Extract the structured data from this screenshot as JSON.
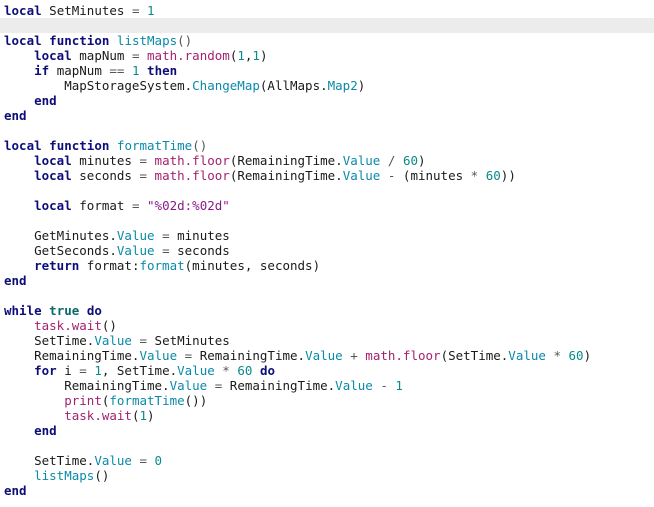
{
  "editor": {
    "lines": [
      [
        {
          "t": "kw",
          "v": "local"
        },
        {
          "t": "plain",
          "v": " SetMinutes "
        },
        {
          "t": "op",
          "v": "="
        },
        {
          "t": "plain",
          "v": " "
        },
        {
          "t": "num",
          "v": "1"
        }
      ],
      [],
      [
        {
          "t": "kw",
          "v": "local"
        },
        {
          "t": "plain",
          "v": " "
        },
        {
          "t": "kw",
          "v": "function"
        },
        {
          "t": "plain",
          "v": " "
        },
        {
          "t": "fn",
          "v": "listMaps"
        },
        {
          "t": "op",
          "v": "()"
        }
      ],
      [
        {
          "t": "plain",
          "v": "    "
        },
        {
          "t": "kw",
          "v": "local"
        },
        {
          "t": "plain",
          "v": " mapNum "
        },
        {
          "t": "op",
          "v": "="
        },
        {
          "t": "plain",
          "v": " "
        },
        {
          "t": "bi",
          "v": "math.random"
        },
        {
          "t": "plain",
          "v": "("
        },
        {
          "t": "num",
          "v": "1"
        },
        {
          "t": "plain",
          "v": ","
        },
        {
          "t": "num",
          "v": "1"
        },
        {
          "t": "plain",
          "v": ")"
        }
      ],
      [
        {
          "t": "plain",
          "v": "    "
        },
        {
          "t": "kw",
          "v": "if"
        },
        {
          "t": "plain",
          "v": " mapNum "
        },
        {
          "t": "op",
          "v": "=="
        },
        {
          "t": "plain",
          "v": " "
        },
        {
          "t": "num",
          "v": "1"
        },
        {
          "t": "plain",
          "v": " "
        },
        {
          "t": "kw",
          "v": "then"
        }
      ],
      [
        {
          "t": "plain",
          "v": "        MapStorageSystem."
        },
        {
          "t": "pr",
          "v": "ChangeMap"
        },
        {
          "t": "plain",
          "v": "(AllMaps."
        },
        {
          "t": "pr",
          "v": "Map2"
        },
        {
          "t": "plain",
          "v": ")"
        }
      ],
      [
        {
          "t": "plain",
          "v": "    "
        },
        {
          "t": "kw",
          "v": "end"
        }
      ],
      [
        {
          "t": "kw",
          "v": "end"
        }
      ],
      [],
      [
        {
          "t": "kw",
          "v": "local"
        },
        {
          "t": "plain",
          "v": " "
        },
        {
          "t": "kw",
          "v": "function"
        },
        {
          "t": "plain",
          "v": " "
        },
        {
          "t": "fn",
          "v": "formatTime"
        },
        {
          "t": "op",
          "v": "()"
        }
      ],
      [
        {
          "t": "plain",
          "v": "    "
        },
        {
          "t": "kw",
          "v": "local"
        },
        {
          "t": "plain",
          "v": " minutes "
        },
        {
          "t": "op",
          "v": "="
        },
        {
          "t": "plain",
          "v": " "
        },
        {
          "t": "bi",
          "v": "math.floor"
        },
        {
          "t": "plain",
          "v": "(RemainingTime."
        },
        {
          "t": "pr",
          "v": "Value"
        },
        {
          "t": "plain",
          "v": " "
        },
        {
          "t": "op",
          "v": "/"
        },
        {
          "t": "plain",
          "v": " "
        },
        {
          "t": "num",
          "v": "60"
        },
        {
          "t": "plain",
          "v": ")"
        }
      ],
      [
        {
          "t": "plain",
          "v": "    "
        },
        {
          "t": "kw",
          "v": "local"
        },
        {
          "t": "plain",
          "v": " seconds "
        },
        {
          "t": "op",
          "v": "="
        },
        {
          "t": "plain",
          "v": " "
        },
        {
          "t": "bi",
          "v": "math.floor"
        },
        {
          "t": "plain",
          "v": "(RemainingTime."
        },
        {
          "t": "pr",
          "v": "Value"
        },
        {
          "t": "plain",
          "v": " "
        },
        {
          "t": "op",
          "v": "-"
        },
        {
          "t": "plain",
          "v": " (minutes "
        },
        {
          "t": "op",
          "v": "*"
        },
        {
          "t": "plain",
          "v": " "
        },
        {
          "t": "num",
          "v": "60"
        },
        {
          "t": "plain",
          "v": "))"
        }
      ],
      [],
      [
        {
          "t": "plain",
          "v": "    "
        },
        {
          "t": "kw",
          "v": "local"
        },
        {
          "t": "plain",
          "v": " format "
        },
        {
          "t": "op",
          "v": "="
        },
        {
          "t": "plain",
          "v": " "
        },
        {
          "t": "str",
          "v": "\"%02d:%02d\""
        }
      ],
      [],
      [
        {
          "t": "plain",
          "v": "    GetMinutes."
        },
        {
          "t": "pr",
          "v": "Value"
        },
        {
          "t": "plain",
          "v": " "
        },
        {
          "t": "op",
          "v": "="
        },
        {
          "t": "plain",
          "v": " minutes"
        }
      ],
      [
        {
          "t": "plain",
          "v": "    GetSeconds."
        },
        {
          "t": "pr",
          "v": "Value"
        },
        {
          "t": "plain",
          "v": " "
        },
        {
          "t": "op",
          "v": "="
        },
        {
          "t": "plain",
          "v": " seconds"
        }
      ],
      [
        {
          "t": "plain",
          "v": "    "
        },
        {
          "t": "kw",
          "v": "return"
        },
        {
          "t": "plain",
          "v": " format:"
        },
        {
          "t": "pr",
          "v": "format"
        },
        {
          "t": "plain",
          "v": "(minutes, seconds)"
        }
      ],
      [
        {
          "t": "kw",
          "v": "end"
        }
      ],
      [],
      [
        {
          "t": "kw",
          "v": "while"
        },
        {
          "t": "plain",
          "v": " "
        },
        {
          "t": "tc",
          "v": "true"
        },
        {
          "t": "plain",
          "v": " "
        },
        {
          "t": "kw",
          "v": "do"
        }
      ],
      [
        {
          "t": "plain",
          "v": "    "
        },
        {
          "t": "bi",
          "v": "task.wait"
        },
        {
          "t": "plain",
          "v": "()"
        }
      ],
      [
        {
          "t": "plain",
          "v": "    SetTime."
        },
        {
          "t": "pr",
          "v": "Value"
        },
        {
          "t": "plain",
          "v": " "
        },
        {
          "t": "op",
          "v": "="
        },
        {
          "t": "plain",
          "v": " SetMinutes"
        }
      ],
      [
        {
          "t": "plain",
          "v": "    RemainingTime."
        },
        {
          "t": "pr",
          "v": "Value"
        },
        {
          "t": "plain",
          "v": " "
        },
        {
          "t": "op",
          "v": "="
        },
        {
          "t": "plain",
          "v": " RemainingTime."
        },
        {
          "t": "pr",
          "v": "Value"
        },
        {
          "t": "plain",
          "v": " "
        },
        {
          "t": "op",
          "v": "+"
        },
        {
          "t": "plain",
          "v": " "
        },
        {
          "t": "bi",
          "v": "math.floor"
        },
        {
          "t": "plain",
          "v": "(SetTime."
        },
        {
          "t": "pr",
          "v": "Value"
        },
        {
          "t": "plain",
          "v": " "
        },
        {
          "t": "op",
          "v": "*"
        },
        {
          "t": "plain",
          "v": " "
        },
        {
          "t": "num",
          "v": "60"
        },
        {
          "t": "plain",
          "v": ")"
        }
      ],
      [
        {
          "t": "plain",
          "v": "    "
        },
        {
          "t": "kw",
          "v": "for"
        },
        {
          "t": "plain",
          "v": " i "
        },
        {
          "t": "op",
          "v": "="
        },
        {
          "t": "plain",
          "v": " "
        },
        {
          "t": "num",
          "v": "1"
        },
        {
          "t": "plain",
          "v": ", SetTime."
        },
        {
          "t": "pr",
          "v": "Value"
        },
        {
          "t": "plain",
          "v": " "
        },
        {
          "t": "op",
          "v": "*"
        },
        {
          "t": "plain",
          "v": " "
        },
        {
          "t": "num",
          "v": "60"
        },
        {
          "t": "plain",
          "v": " "
        },
        {
          "t": "kw",
          "v": "do"
        }
      ],
      [
        {
          "t": "plain",
          "v": "        RemainingTime."
        },
        {
          "t": "pr",
          "v": "Value"
        },
        {
          "t": "plain",
          "v": " "
        },
        {
          "t": "op",
          "v": "="
        },
        {
          "t": "plain",
          "v": " RemainingTime."
        },
        {
          "t": "pr",
          "v": "Value"
        },
        {
          "t": "plain",
          "v": " "
        },
        {
          "t": "op",
          "v": "-"
        },
        {
          "t": "plain",
          "v": " "
        },
        {
          "t": "num",
          "v": "1"
        }
      ],
      [
        {
          "t": "plain",
          "v": "        "
        },
        {
          "t": "bi",
          "v": "print"
        },
        {
          "t": "plain",
          "v": "("
        },
        {
          "t": "fn",
          "v": "formatTime"
        },
        {
          "t": "plain",
          "v": "())"
        }
      ],
      [
        {
          "t": "plain",
          "v": "        "
        },
        {
          "t": "bi",
          "v": "task.wait"
        },
        {
          "t": "plain",
          "v": "("
        },
        {
          "t": "num",
          "v": "1"
        },
        {
          "t": "plain",
          "v": ")"
        }
      ],
      [
        {
          "t": "plain",
          "v": "    "
        },
        {
          "t": "kw",
          "v": "end"
        }
      ],
      [],
      [
        {
          "t": "plain",
          "v": "    SetTime."
        },
        {
          "t": "pr",
          "v": "Value"
        },
        {
          "t": "plain",
          "v": " "
        },
        {
          "t": "op",
          "v": "="
        },
        {
          "t": "plain",
          "v": " "
        },
        {
          "t": "num",
          "v": "0"
        }
      ],
      [
        {
          "t": "plain",
          "v": "    "
        },
        {
          "t": "fn",
          "v": "listMaps"
        },
        {
          "t": "plain",
          "v": "()"
        }
      ],
      [
        {
          "t": "kw",
          "v": "end"
        }
      ]
    ],
    "highlighted_line": 2
  },
  "colors": {
    "keyword": "#0d0d7a",
    "function_name": "#0a8aa8",
    "builtin": "#a3226e",
    "number": "#0b8a8a",
    "string": "#8a1a8a",
    "property": "#0a8aa8",
    "line_highlight": "#ececec",
    "background": "#ffffff"
  }
}
